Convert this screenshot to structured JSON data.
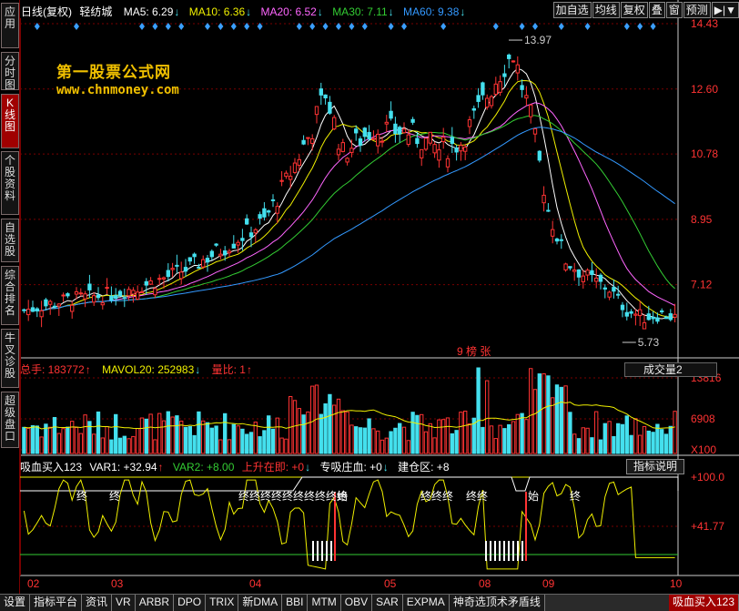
{
  "side_tabs": [
    {
      "label": "应用",
      "active": false
    },
    {
      "label": "分时图",
      "active": false
    },
    {
      "label": "K线图",
      "active": true
    },
    {
      "label": "个股资料",
      "active": false
    },
    {
      "label": "自选股",
      "active": false
    },
    {
      "label": "综合排名",
      "active": false
    },
    {
      "label": "牛叉诊股",
      "active": false
    },
    {
      "label": "超级盘口",
      "active": false
    }
  ],
  "main_header": {
    "period": "日线(复权)",
    "stock": "轻纺城",
    "ma5": "MA5: 6.29",
    "ma10": "MA10: 6.36",
    "ma20": "MA20: 6.52",
    "ma30": "MA30: 7.11",
    "ma60": "MA60: 9.38",
    "arrow": "↓",
    "colors": {
      "ma5": "#ffffff",
      "ma10": "#f0f000",
      "ma20": "#ff66ff",
      "ma30": "#33cc33",
      "ma60": "#3399ff"
    }
  },
  "toolbar": [
    "加自选",
    "均线",
    "复权",
    "叠",
    "窗",
    "预测",
    "▶|▼"
  ],
  "watermark": {
    "line1": "第一股票公式网",
    "line2": "www.chnmoney.com"
  },
  "price_axis": [
    "14.43",
    "12.60",
    "10.78",
    "8.95",
    "7.12"
  ],
  "annotations": {
    "high": "13.97",
    "low": "5.73",
    "mid_marks": "9 榜 张"
  },
  "volume_header": {
    "total": "总手: 183772",
    "total_arrow": "↑",
    "mavol": "MAVOL20: 252983",
    "mavol_arrow": "↓",
    "ratio": "量比: 1",
    "ratio_arrow": "↑"
  },
  "volume_dropdown": "成交量2",
  "volume_axis": [
    "13816",
    "6908",
    "X100"
  ],
  "ind_header": {
    "name": "吸血买入123",
    "var1": "VAR1: +32.94",
    "var1_arrow": "↑",
    "var2": "VAR2: +8.00",
    "up": "上升在即: +0",
    "zhuang": "专吸庄血: +0",
    "jiancang": "建仓区: +8",
    "down_arrow": "↓"
  },
  "ind_help": "指标说明",
  "ind_axis": [
    "+100.0",
    "+41.77"
  ],
  "ind_labels": {
    "zhong": "终",
    "shi": "始"
  },
  "date_axis": [
    "02",
    "03",
    "04",
    "05",
    "08",
    "09",
    "10"
  ],
  "bottom_tabs": [
    "设置",
    "指标平台",
    "资讯",
    "VR",
    "ARBR",
    "DPO",
    "TRIX",
    "新DMA",
    "BBI",
    "MTM",
    "OBV",
    "SAR",
    "EXPMA",
    "神奇选顶术矛盾线",
    "吸血买入123"
  ],
  "bottom_active": "吸血买入123",
  "colors": {
    "up": "#ff3333",
    "down": "#44e0ee",
    "grid": "#7a0000",
    "axis_text": "#ff3333",
    "diamond": "#3a9fff"
  }
}
